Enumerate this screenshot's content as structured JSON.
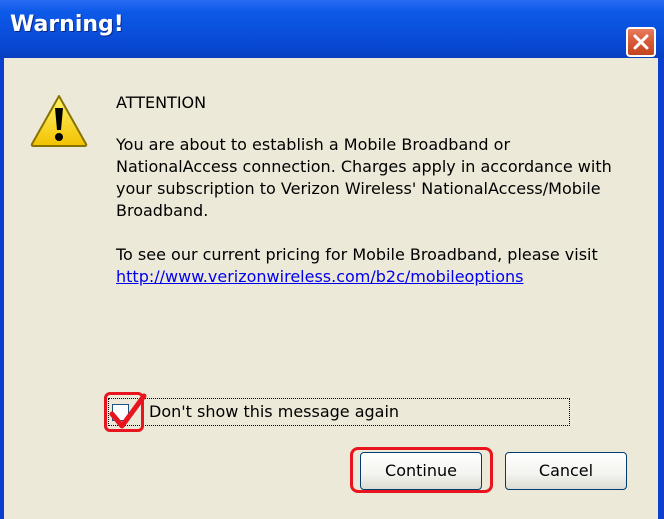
{
  "window": {
    "title": "Warning!",
    "close_icon": "close-icon"
  },
  "message": {
    "heading": "ATTENTION",
    "body": "You are about to establish a Mobile Broadband or NationalAccess connection.  Charges apply in accordance with your subscription to Verizon Wireless' NationalAccess/Mobile Broadband.",
    "pricing_text": "To see our current pricing for Mobile Broadband, please visit ",
    "pricing_link": "http://www.verizonwireless.com/b2c/mobileoptions",
    "icon": "warning-icon"
  },
  "checkbox": {
    "label": "Don't show this message again",
    "checked": true
  },
  "buttons": {
    "continue_label": "Continue",
    "cancel_label": "Cancel"
  },
  "colors": {
    "titlebar": "#0a4fdc",
    "client": "#ece9d8",
    "highlight": "#e8141e",
    "link": "#0000ee"
  }
}
